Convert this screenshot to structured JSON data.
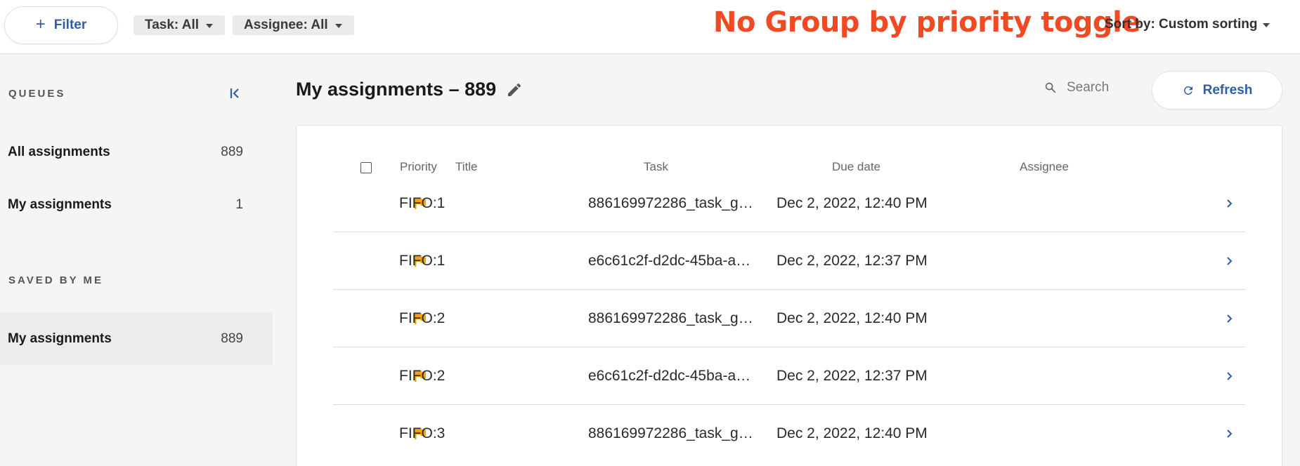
{
  "topbar": {
    "filter_label": "Filter",
    "task_chip": "Task: All",
    "assignee_chip": "Assignee: All",
    "annotation": "No Group by priority toggle",
    "sort_label": "Sort by: Custom sorting"
  },
  "sidebar": {
    "queues_title": "QUEUES",
    "saved_title": "SAVED BY ME",
    "queues": [
      {
        "label": "All assignments",
        "count": "889"
      },
      {
        "label": "My assignments",
        "count": "1"
      }
    ],
    "saved": [
      {
        "label": "My assignments",
        "count": "889"
      }
    ]
  },
  "main": {
    "title": "My assignments – 889",
    "search_placeholder": "Search",
    "refresh_label": "Refresh"
  },
  "table": {
    "columns": {
      "priority": "Priority",
      "title": "Title",
      "task": "Task",
      "due": "Due date",
      "assignee": "Assignee"
    },
    "rows": [
      {
        "title": "FIFO:1",
        "task": "886169972286_task_g…",
        "due": "Dec 2, 2022, 12:40 PM",
        "assignee": ""
      },
      {
        "title": "FIFO:1",
        "task": "e6c61c2f-d2dc-45ba-a…",
        "due": "Dec 2, 2022, 12:37 PM",
        "assignee": ""
      },
      {
        "title": "FIFO:2",
        "task": "886169972286_task_g…",
        "due": "Dec 2, 2022, 12:40 PM",
        "assignee": ""
      },
      {
        "title": "FIFO:2",
        "task": "e6c61c2f-d2dc-45ba-a…",
        "due": "Dec 2, 2022, 12:37 PM",
        "assignee": ""
      },
      {
        "title": "FIFO:3",
        "task": "886169972286_task_g…",
        "due": "Dec 2, 2022, 12:40 PM",
        "assignee": ""
      }
    ]
  },
  "icons": {
    "priority_flag": "flag-icon",
    "row_open": "chevron-right-icon",
    "collapse": "collapse-left-icon",
    "edit": "pencil-icon",
    "search": "search-icon",
    "refresh": "refresh-icon"
  },
  "colors": {
    "accent": "#2f5ea8",
    "annotation": "#ef4a23",
    "flag": "#f0a30a"
  }
}
